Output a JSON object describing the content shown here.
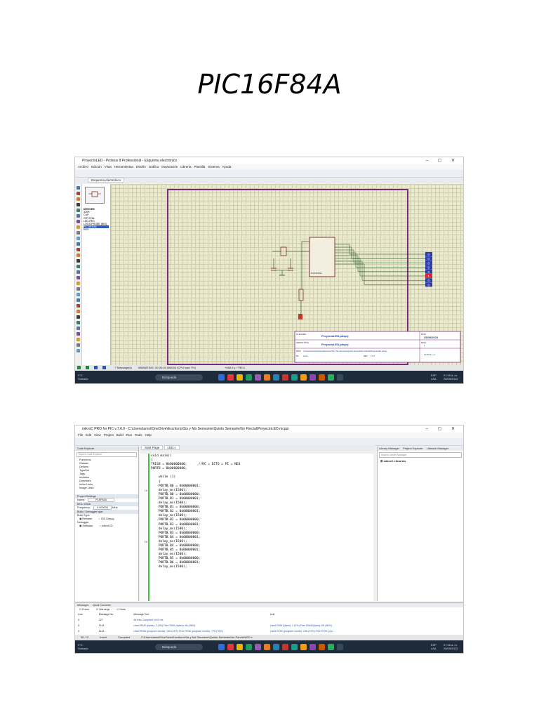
{
  "document": {
    "title": "PIC16F84A"
  },
  "screenshot1": {
    "window_title": "ProyectoLED - Proteus 8 Professional - Esquema electrónico",
    "menu": [
      "Archivo",
      "Edición",
      "Vista",
      "Herramientas",
      "Diseño",
      "Gráfico",
      "Depuración",
      "Librería",
      "Plantilla",
      "Sistema",
      "Ayuda"
    ],
    "tab": "Esquema electrónico",
    "devices_header": "DEVICES",
    "devices": [
      "330R",
      "CAP",
      "CRYSTAL",
      "LED-RED",
      "LOGICPROBE (BIG)",
      "PIC16F84A",
      "RES"
    ],
    "selected_device_index": 5,
    "status_messages": "7 Message(s)",
    "status_anim": "ANIMATING: 00:00:16.908000 (CPU load 7%)",
    "status_coords": "+468.0  y  +750.0",
    "chip_label": "PIC16F84A",
    "probe_values": [
      "0",
      "0",
      "0",
      "0",
      "0",
      "1",
      "0",
      "0"
    ],
    "titleblock": {
      "filename_label": "FILE NAME:",
      "filename": "ProyectoLED.pdsprj",
      "design_label": "DESIGN TITLE:",
      "design": "ProyectoLED.pdsprj",
      "date_label": "DATE:",
      "date": "25/09/2023",
      "page_label": "PAGE:",
      "page": "1",
      "path_label": "PATH:",
      "path": "C:\\Users\\iamsi\\OneDrive\\Escritorio\\Sis y Mo Semestre\\Quinto Semestre\\for Parcial\\ProyectoLED.pdsprj",
      "by_label": "BY:",
      "by": "Iturbe",
      "rev_label": "REV:",
      "rev": "1.0.0",
      "time": "19:18:15 a. m."
    },
    "taskbar": {
      "weather_temp": "9°C",
      "weather_desc": "Soleado",
      "search": "Búsqueda",
      "lang1": "ESP",
      "lang2": "LAA",
      "time": "07:45 a. m.",
      "date": "26/09/2023"
    }
  },
  "screenshot2": {
    "window_title": "mikroC PRO for PIC v.7.6.0 - C:\\Users\\iamsi\\OneDrive\\Escritorio\\Sis y Mo Semestre\\Quinto Semestre\\for Parcial\\ProyectoLED.mcppi",
    "menu": [
      "File",
      "Edit",
      "View",
      "Project",
      "Build",
      "Run",
      "Tools",
      "Help"
    ],
    "tabs": [
      "Start Page",
      "LED.c"
    ],
    "right_tabs": [
      "Library Manager",
      "Project Explorer",
      "Libstock Manager"
    ],
    "left_panel": {
      "code_explorer": "Code Explorer",
      "search_placeholder": "Search Code Explorer",
      "tree": [
        "Functions",
        "Globals",
        "Defines",
        "TypeDef",
        "Tags",
        "Includes",
        "Directives",
        "Inline Links",
        "Image Links"
      ],
      "project_settings": "Project Settings",
      "device_label": "Name:",
      "device": "P16F84A",
      "mcu_clock": "MCU Clock",
      "frequency_label": "Frequency:",
      "frequency": "4.000000",
      "freq_unit": "MHz",
      "build_header": "Build / Debugger type",
      "build_type": "Build Type",
      "release": "Release",
      "icd_debug": "ICD Debug",
      "debugger": "Debugger",
      "software": "Software",
      "mikroicd": "mikroICD"
    },
    "library_search": "Search Library Manager",
    "library_root": "mikroC Libraries",
    "code_lines": [
      "void main()",
      "{",
      "TRISB = 0b00000000;      //RC = ECTO = PI = NEO",
      "PORTB = 0b00000000;",
      "",
      "    while (1)",
      "    {",
      "    PORTB.B0 = 0b00000001;",
      "    delay_ms(1500);",
      "    PORTB.B0 = 0b00000000;",
      "    PORTB.B1 = 0b00000001;",
      "    delay_ms(1500);",
      "    PORTB.B1 = 0b00000000;",
      "    PORTB.B2 = 0b00000001;",
      "    delay_ms(1500);",
      "    PORTB.B2 = 0b00000000;",
      "    PORTB.B3 = 0b00000001;",
      "    delay_ms(1500);",
      "    PORTB.B3 = 0b00000000;",
      "    PORTB.B4 = 0b00000001;",
      "    delay_ms(1500);",
      "    PORTB.B4 = 0b00000000;",
      "    PORTB.B5 = 0b00000001;",
      "    delay_ms(1500);",
      "    PORTB.B5 = 0b00000000;",
      "    PORTB.B6 = 0b00000001;",
      "    delay_ms(1500);"
    ],
    "line_numbers": [
      "",
      "",
      "",
      "",
      "",
      "",
      "",
      "",
      "10",
      "",
      "",
      "",
      "",
      "",
      "",
      "",
      "",
      "",
      "",
      "",
      "20",
      "",
      "",
      "",
      "",
      "",
      ""
    ],
    "messages": {
      "tabs": [
        "Messages",
        "Quick Converter"
      ],
      "filters": [
        "Errors",
        "Warnings",
        "Hints"
      ],
      "headers": [
        "Line",
        "Message No.",
        "Message Text",
        "Unit"
      ],
      "rows": [
        [
          "0",
          "327",
          "All files Compiled in 63 ms",
          ""
        ],
        [
          "0",
          "1144",
          "Used RAM (bytes): 2 (3%)  Free RAM (bytes): 66 (96%)",
          "Used RAM (bytes): 2 (3%)  Free RAM (bytes): 66 (96%)"
        ],
        [
          "0",
          "1144",
          "Used ROM (program words): 246 (24%)  Free ROM (program words): 778 (76%)",
          "Used ROM (program words): 246 (24%)  Free ROM (pro..."
        ]
      ]
    },
    "status": [
      "30: 12",
      "Insert",
      "Compiled",
      "C:\\Users\\iamsi\\OneDrive\\Escritorio\\Sis y Mo Semestre\\Quinto Semestre\\for Parcial\\LED.c"
    ],
    "taskbar": {
      "weather_temp": "9°C",
      "weather_desc": "Soleado",
      "search": "Búsqueda",
      "lang1": "ESP",
      "lang2": "LAA",
      "time": "07:46 a. m.",
      "date": "26/09/2023"
    }
  }
}
